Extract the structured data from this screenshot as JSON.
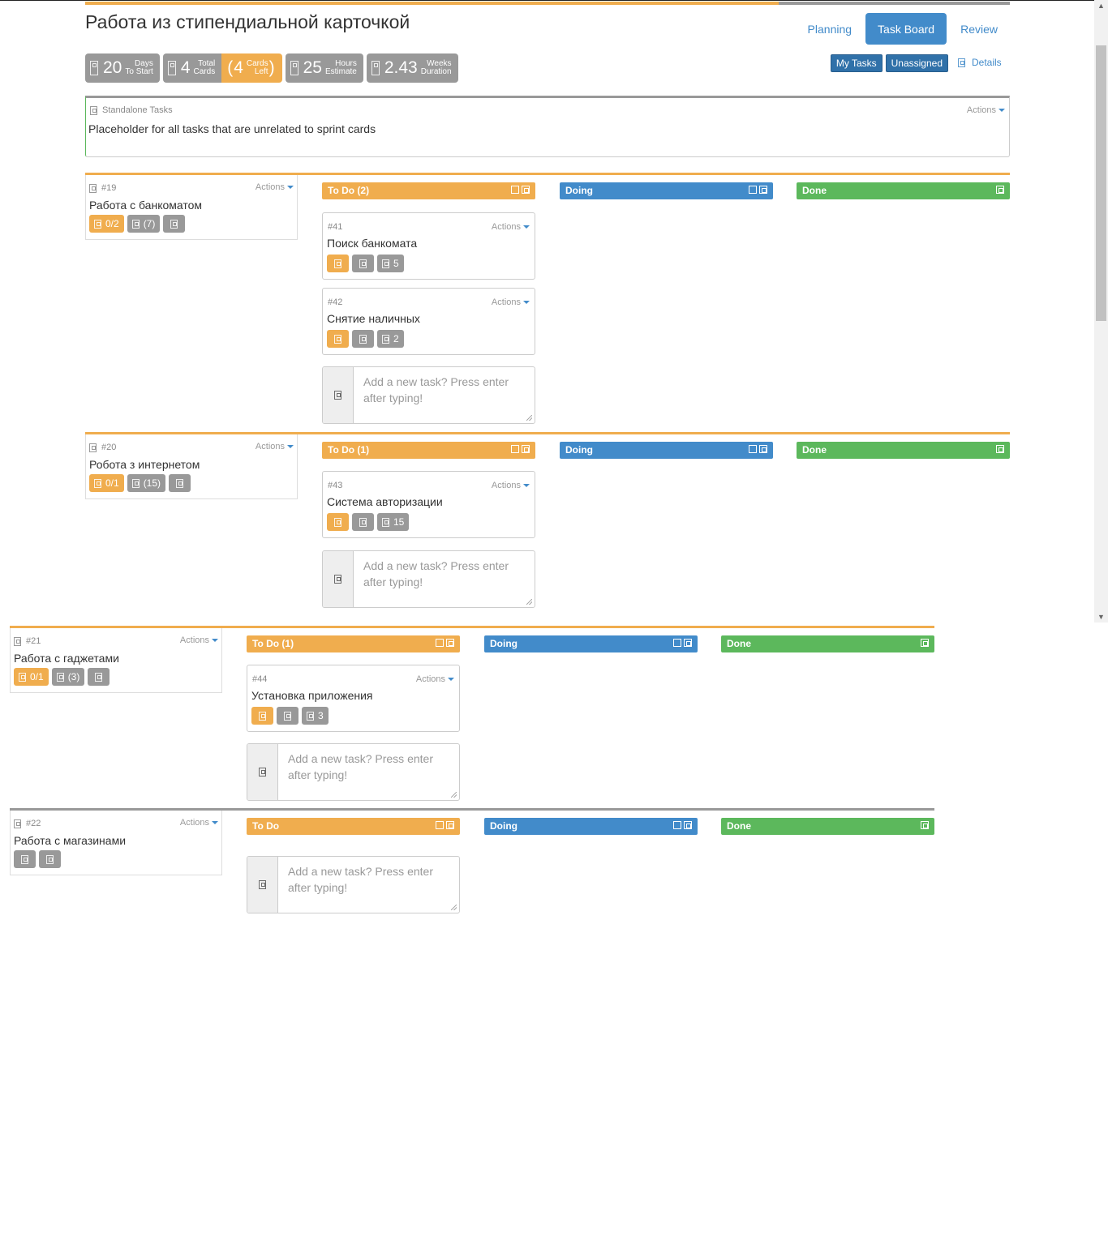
{
  "app": {
    "title": "Работа из стипендиальной карточкой",
    "nav": {
      "planning": "Planning",
      "task_board": "Task Board",
      "review": "Review"
    },
    "progress": {
      "fraction": 0.75
    }
  },
  "stats": {
    "days": {
      "value": "20",
      "line1": "Days",
      "line2": "To Start"
    },
    "total_cards": {
      "value": "4",
      "line1": "Total",
      "line2": "Cards"
    },
    "cards_left": {
      "open": "(",
      "value": "4",
      "line1": "Cards",
      "line2": "Left",
      "close": ")"
    },
    "hours": {
      "value": "25",
      "line1": "Hours",
      "line2": "Estimate"
    },
    "weeks": {
      "value": "2.43",
      "line1": "Weeks",
      "line2": "Duration"
    }
  },
  "filters": {
    "my_tasks": "My Tasks",
    "unassigned": "Unassigned",
    "details": "Details"
  },
  "standalone": {
    "label": "Standalone Tasks",
    "description": "Placeholder for all tasks that are unrelated to sprint cards",
    "actions": "Actions"
  },
  "columns": {
    "doing": "Doing",
    "done": "Done"
  },
  "add_task_placeholder": "Add a new task? Press enter after typing!",
  "rows": [
    {
      "card": {
        "number": "#19",
        "title": "Работа с банкоматом",
        "actions": "Actions",
        "progress": "0/2",
        "hours": "(7)"
      },
      "todo_label": "To Do (2)",
      "tasks": [
        {
          "number": "#41",
          "title": "Поиск банкомата",
          "actions": "Actions",
          "hours": "5"
        },
        {
          "number": "#42",
          "title": "Снятие наличных",
          "actions": "Actions",
          "hours": "2"
        }
      ]
    },
    {
      "card": {
        "number": "#20",
        "title": "Робота з интернетом",
        "actions": "Actions",
        "progress": "0/1",
        "hours": "(15)"
      },
      "todo_label": "To Do (1)",
      "tasks": [
        {
          "number": "#43",
          "title": "Система авторизации",
          "actions": "Actions",
          "hours": "15"
        }
      ]
    },
    {
      "card": {
        "number": "#21",
        "title": "Работа с гаджетами",
        "actions": "Actions",
        "progress": "0/1",
        "hours": "(3)"
      },
      "todo_label": "To Do (1)",
      "tasks": [
        {
          "number": "#44",
          "title": "Установка приложения",
          "actions": "Actions",
          "hours": "3"
        }
      ]
    },
    {
      "card": {
        "number": "#22",
        "title": "Работа с магазинами",
        "actions": "Actions"
      },
      "todo_label": "To Do",
      "tasks": []
    }
  ],
  "colors": {
    "orange": "#f0ad4e",
    "blue": "#428bca",
    "green": "#5cb85c",
    "gray": "#999999"
  }
}
